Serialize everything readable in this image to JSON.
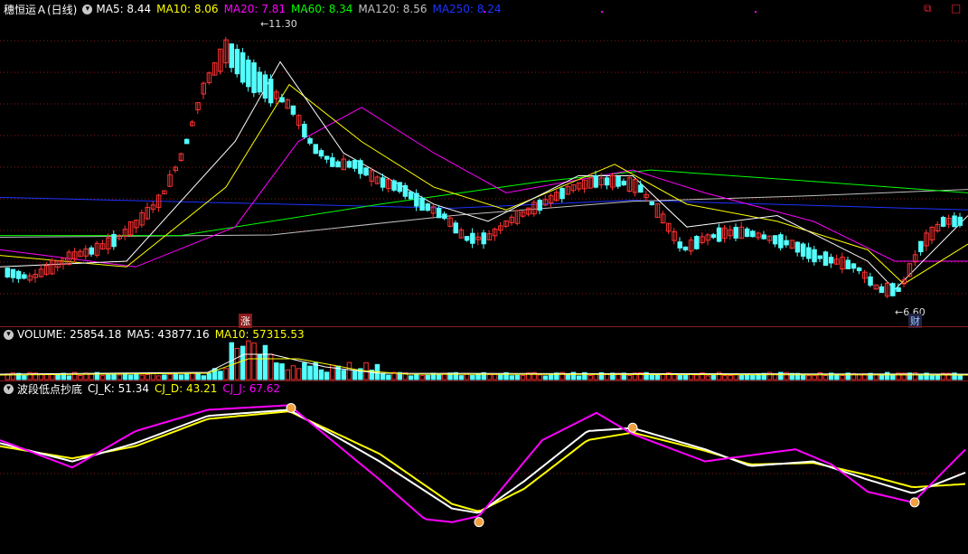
{
  "main_header": {
    "stock": "穗恒运Ａ(日线)",
    "ma5": "MA5: 8.44",
    "ma10": "MA10: 8.06",
    "ma20": "MA20: 7.81",
    "ma60": "MA60: 8.34",
    "ma120": "MA120: 8.56",
    "ma250": "MA250: 8.24"
  },
  "vol_header": {
    "volume": "VOLUME: 25854.18",
    "ma5": "MA5: 43877.16",
    "ma10": "MA10: 57315.53"
  },
  "osc_header": {
    "name": "波段低点抄底",
    "k": "CJ_K: 51.34",
    "d": "CJ_D: 43.21",
    "j": "CJ_J: 67.62"
  },
  "annotations": {
    "high": "11.30",
    "low": "6.60",
    "zhang": "涨",
    "cai": "财"
  },
  "window_controls": {
    "restore": "⧉",
    "maximize": "□"
  },
  "colors": {
    "bg": "#000000",
    "up": "#ff3232",
    "down": "#54ffff",
    "ma5": "#ffffff",
    "ma10": "#ffff00",
    "ma20": "#ff00ff",
    "ma60": "#00ff00",
    "ma120": "#c0c0c0",
    "ma250": "#1e32ff",
    "grid": "#8b1a1a"
  },
  "chart_data": [
    {
      "type": "candlestick",
      "title": "穗恒运Ａ(日线)",
      "ylim": [
        6.3,
        11.6
      ],
      "high_mark": 11.3,
      "low_mark": 6.6,
      "ma_lines": [
        "MA5: 8.44",
        "MA10: 8.06",
        "MA20: 7.81",
        "MA60: 8.34",
        "MA120: 8.56",
        "MA250: 8.24"
      ],
      "close_path": [
        7.1,
        7.0,
        7.2,
        7.4,
        7.5,
        7.7,
        8.0,
        8.4,
        9.2,
        10.4,
        11.0,
        10.6,
        10.3,
        10.0,
        9.3,
        9.0,
        9.0,
        8.7,
        8.6,
        8.3,
        8.1,
        7.7,
        7.7,
        8.0,
        8.2,
        8.4,
        8.6,
        8.7,
        8.7,
        8.6,
        8.1,
        7.5,
        7.7,
        7.8,
        7.8,
        7.7,
        7.6,
        7.4,
        7.3,
        7.2,
        6.8,
        6.8,
        7.6,
        8.0,
        8.0
      ]
    },
    {
      "type": "bar",
      "title": "VOLUME",
      "series": [
        {
          "name": "VOLUME: 25854.18",
          "value": 25854.18
        },
        {
          "name": "MA5: 43877.16",
          "value": 43877.16
        },
        {
          "name": "MA10: 57315.53",
          "value": 57315.53
        }
      ]
    },
    {
      "type": "line",
      "title": "波段低点抄底",
      "ylim": [
        0,
        100
      ],
      "series": [
        {
          "name": "CJ_K",
          "last": 51.34
        },
        {
          "name": "CJ_D",
          "last": 43.21
        },
        {
          "name": "CJ_J",
          "last": 67.62
        }
      ]
    }
  ]
}
